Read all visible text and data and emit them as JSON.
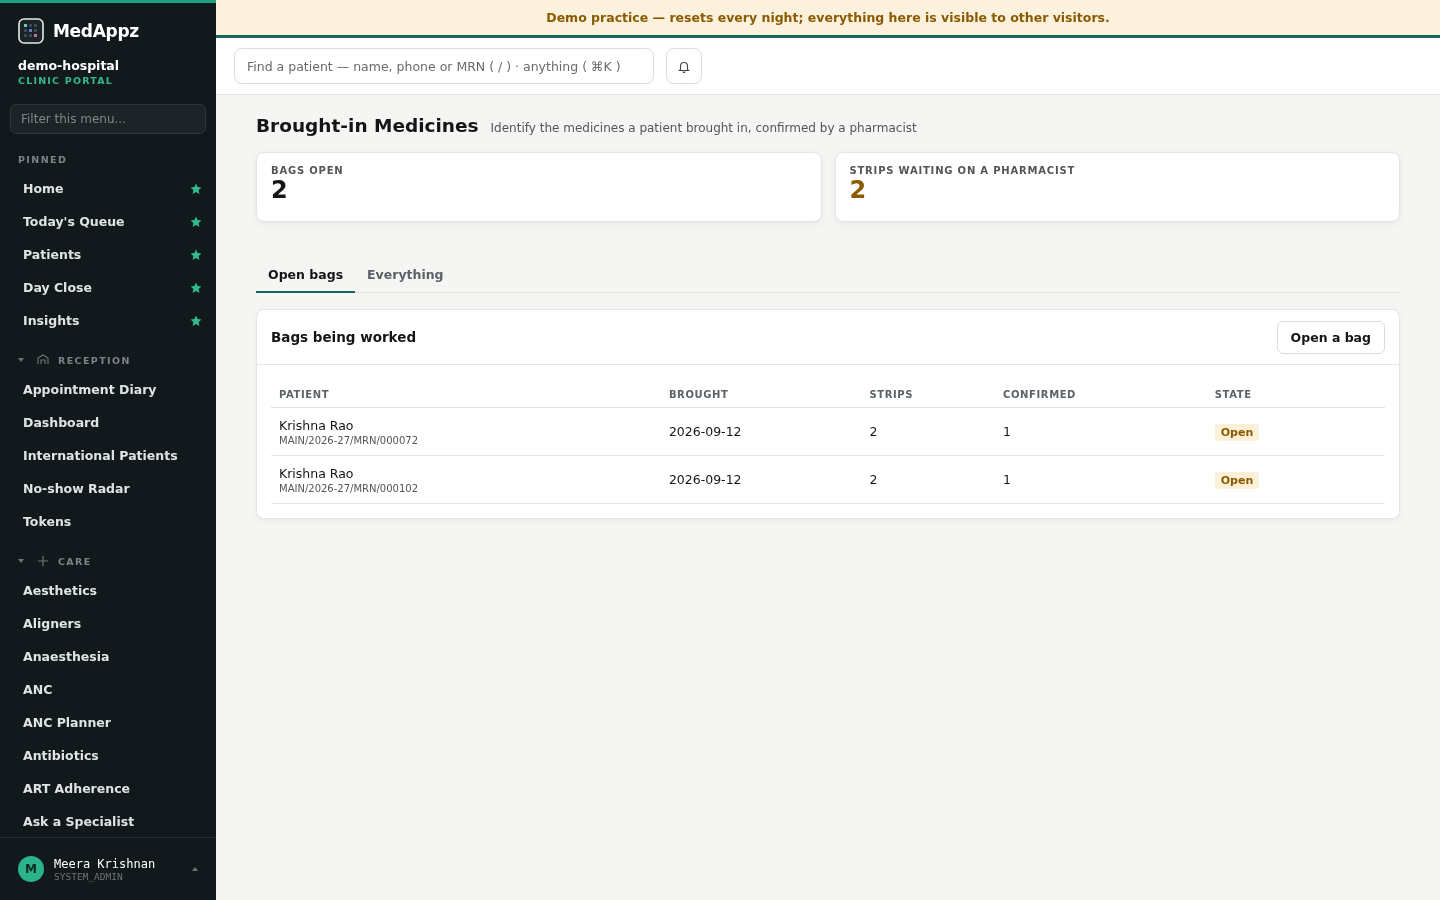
{
  "brand": {
    "name": "MedAppz",
    "org": "demo-hospital",
    "portal": "CLINIC PORTAL"
  },
  "sidebar": {
    "filter_placeholder": "Filter this menu...",
    "sections": [
      {
        "title": "PINNED",
        "items": [
          {
            "label": "Home",
            "starred": true
          },
          {
            "label": "Today's Queue",
            "starred": true
          },
          {
            "label": "Patients",
            "starred": true
          },
          {
            "label": "Day Close",
            "starred": true
          },
          {
            "label": "Insights",
            "starred": true
          }
        ]
      },
      {
        "title": "RECEPTION",
        "expanded": true,
        "items": [
          {
            "label": "Appointment Diary",
            "starred": false
          },
          {
            "label": "Dashboard",
            "starred": false
          },
          {
            "label": "International Patients",
            "starred": false
          },
          {
            "label": "No-show Radar",
            "starred": false
          },
          {
            "label": "Tokens",
            "starred": false
          }
        ]
      },
      {
        "title": "CARE",
        "expanded": true,
        "items": [
          {
            "label": "Aesthetics",
            "starred": false
          },
          {
            "label": "Aligners",
            "starred": false
          },
          {
            "label": "Anaesthesia",
            "starred": false
          },
          {
            "label": "ANC",
            "starred": false
          },
          {
            "label": "ANC Planner",
            "starred": false
          },
          {
            "label": "Antibiotics",
            "starred": false
          },
          {
            "label": "ART Adherence",
            "starred": false
          },
          {
            "label": "Ask a Specialist",
            "starred": false
          }
        ]
      }
    ]
  },
  "user": {
    "initial": "M",
    "name": "Meera Krishnan",
    "role": "SYSTEM_ADMIN"
  },
  "banner": "Demo practice — resets every night; everything here is visible to other visitors.",
  "search": {
    "placeholder": "Find a patient — name, phone or MRN ( / ) · anything ( ⌘K )"
  },
  "page": {
    "title": "Brought-in Medicines",
    "subtitle": "Identify the medicines a patient brought in, confirmed by a pharmacist"
  },
  "stats": [
    {
      "label": "BAGS OPEN",
      "value": "2",
      "color": "#151515"
    },
    {
      "label": "STRIPS WAITING ON A PHARMACIST",
      "value": "2",
      "color": "#8a5a00"
    }
  ],
  "tabs": [
    {
      "label": "Open bags",
      "selected": true
    },
    {
      "label": "Everything",
      "selected": false
    }
  ],
  "panel": {
    "title": "Bags being worked",
    "action": "Open a bag",
    "columns": [
      "PATIENT",
      "BROUGHT",
      "STRIPS",
      "CONFIRMED",
      "STATE"
    ],
    "rows": [
      {
        "patient": "Krishna Rao",
        "mrn": "MAIN/2026-27/MRN/000072",
        "brought": "2026-09-12",
        "strips": "2",
        "confirmed": "1",
        "state": "Open"
      },
      {
        "patient": "Krishna Rao",
        "mrn": "MAIN/2026-27/MRN/000102",
        "brought": "2026-09-12",
        "strips": "2",
        "confirmed": "1",
        "state": "Open"
      }
    ]
  }
}
